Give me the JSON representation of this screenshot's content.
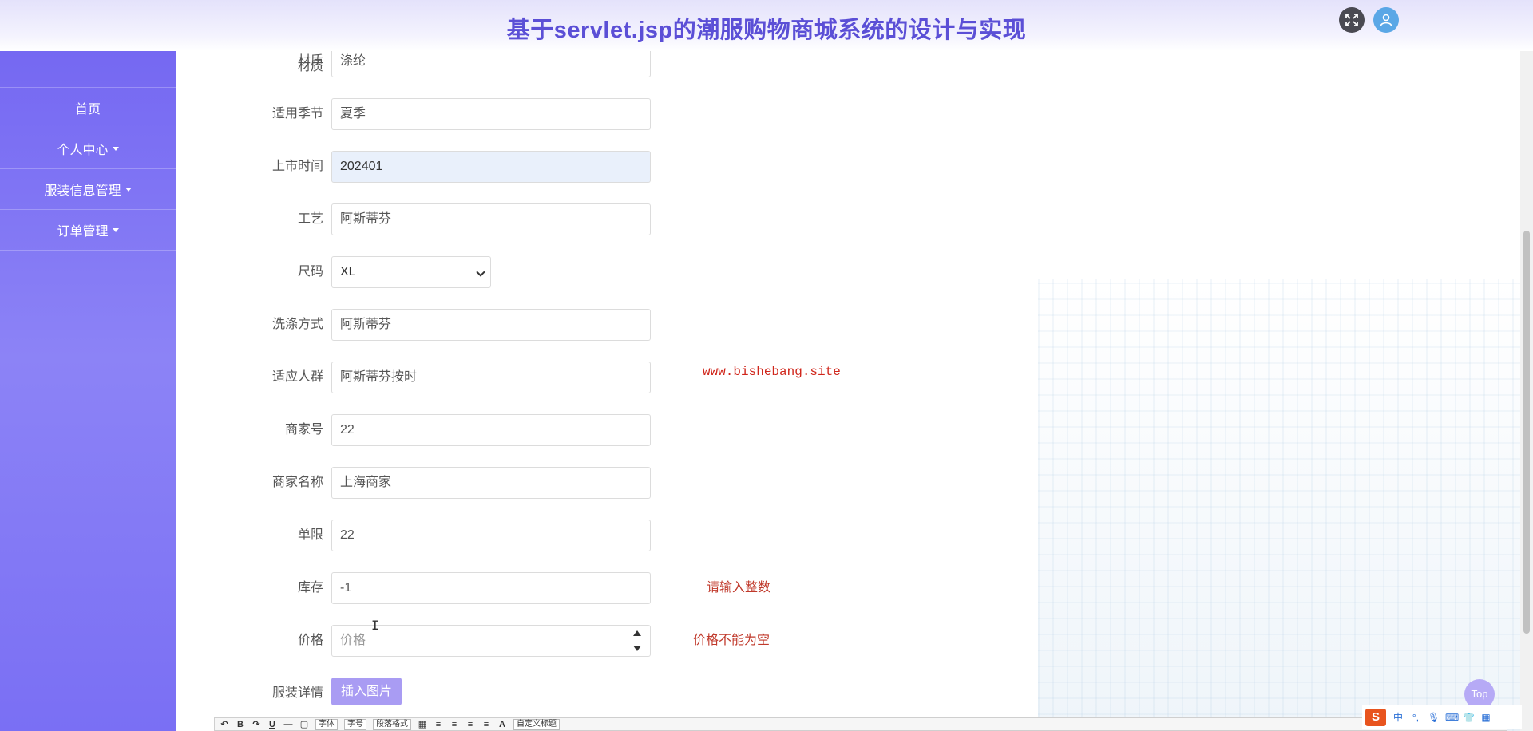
{
  "header": {
    "title": "基于servlet.jsp的潮服购物商城系统的设计与实现"
  },
  "sidebar": {
    "items": [
      {
        "label": "首页"
      },
      {
        "label": "个人中心"
      },
      {
        "label": "服装信息管理"
      },
      {
        "label": "订单管理"
      }
    ]
  },
  "form": {
    "material": {
      "label": "材质",
      "value": "涤纶"
    },
    "season": {
      "label": "适用季节",
      "value": "夏季"
    },
    "release_time": {
      "label": "上市时间",
      "value": "202401"
    },
    "craft": {
      "label": "工艺",
      "value": "阿斯蒂芬"
    },
    "size": {
      "label": "尺码",
      "value": "XL"
    },
    "washing": {
      "label": "洗涤方式",
      "value": "阿斯蒂芬"
    },
    "audience": {
      "label": "适应人群",
      "value": "阿斯蒂芬按时"
    },
    "merchant_no": {
      "label": "商家号",
      "value": "22"
    },
    "merchant_name": {
      "label": "商家名称",
      "value": "上海商家"
    },
    "limit": {
      "label": "单限",
      "value": "22"
    },
    "stock": {
      "label": "库存",
      "value": "-1",
      "error": "请输入整数"
    },
    "price": {
      "label": "价格",
      "placeholder": "价格",
      "error": "价格不能为空"
    },
    "details": {
      "label": "服装详情",
      "insert_image": "插入图片"
    }
  },
  "watermark": "www.bishebang.site",
  "editor_toolbar": {
    "font": "字体",
    "size": "字号",
    "paragraph": "段落格式",
    "custom_title": "自定义标题"
  },
  "top_button": "Top",
  "ime": {
    "mode": "中"
  }
}
